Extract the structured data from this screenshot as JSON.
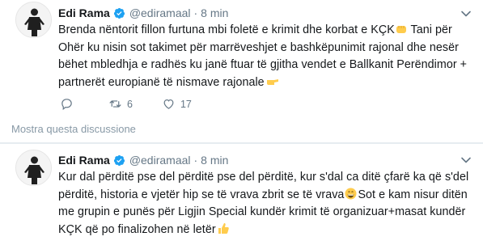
{
  "tweets": [
    {
      "author_name": "Edi Rama",
      "author_handle": "@ediramaal",
      "time": "8 min",
      "text_lines": [
        "Brenda nëntorit fillon furtuna mbi foletë e krimit dhe korbat e KÇK",
        "Ohër ku nisin sot takimet për marrëveshjet e bashkëpunimit rajonal dhe nesër",
        "bëhet mbledhja e radhës ku janë ftuar të gjitha vendet e Ballkanit Perëndimor +",
        "partnerët europianë të nismave rajonale"
      ],
      "text_line1_tail": " Tani për",
      "reply_count": "",
      "retweet_count": "6",
      "like_count": "17"
    },
    {
      "author_name": "Edi Rama",
      "author_handle": "@ediramaal",
      "time": "8 min",
      "text_lines": [
        "Kur dal përditë pse del përditë pse del përditë, kur s'dal ca ditë çfarë ka që s'del",
        "përditë, historia e vjetër hip se të vrava zbrit se të vrava",
        "me grupin e punës për Ligjin Special kundër krimit të organizuar+masat kundër",
        "KÇK që po finalizohen në letër"
      ],
      "text_line2_tail": "Sot e kam nisur ditën"
    }
  ],
  "thread": {
    "show_thread_label": "Mostra questa discussione"
  },
  "colors": {
    "verified": "#1da1f2",
    "muted": "#657786",
    "divider": "#e6ecf0",
    "emoji": "#ffcc4d"
  },
  "icons": [
    "verified-badge-icon",
    "chevron-down-icon",
    "reply-icon",
    "retweet-icon",
    "heart-icon",
    "fist-emoji-icon",
    "pointing-hand-emoji-icon",
    "grin-emoji-icon",
    "thumbs-up-emoji-icon"
  ]
}
